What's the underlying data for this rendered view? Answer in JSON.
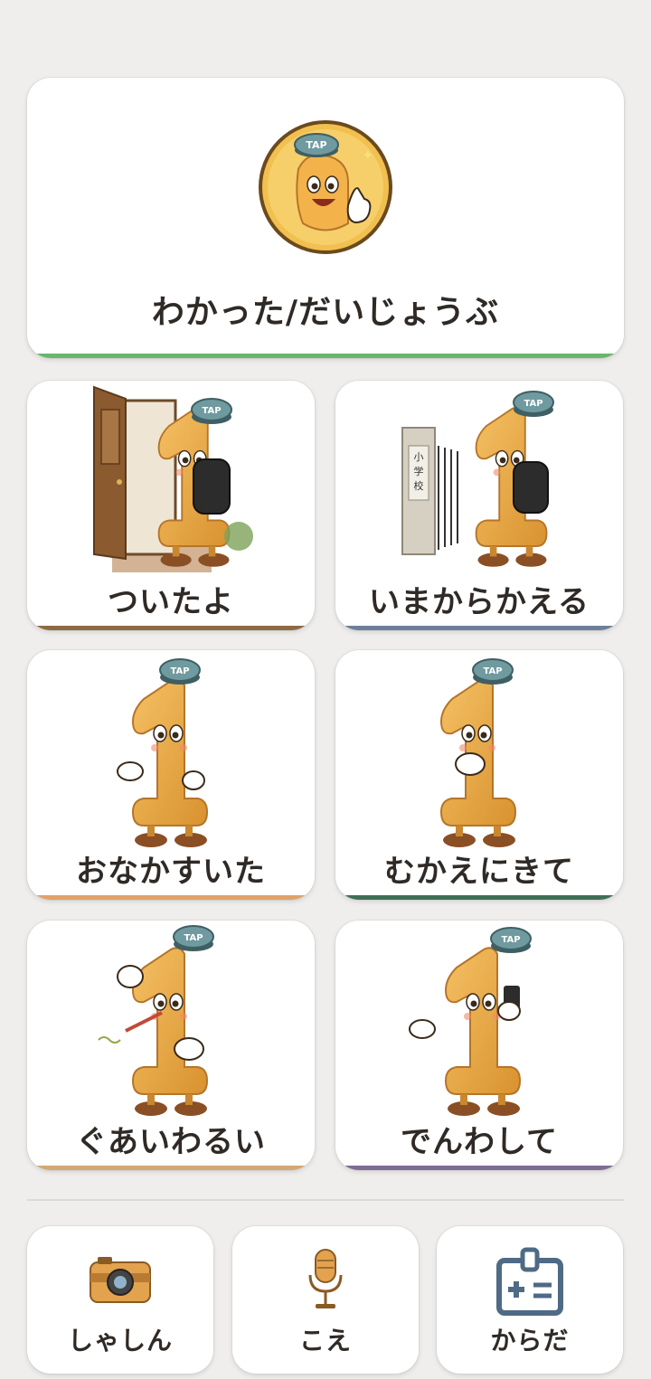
{
  "main_button": {
    "label": "わかった/だいじょうぶ",
    "accent": "#6bb56c",
    "badge_text": "TAP"
  },
  "tiles": [
    {
      "label": "ついたよ",
      "accent": "#8d6a45",
      "badge_text": "TAP",
      "icon": "character-door-icon"
    },
    {
      "label": "いまからかえる",
      "accent": "#6e7f9b",
      "badge_text": "TAP",
      "icon": "character-school-gate-icon",
      "gate_text": "小学校"
    },
    {
      "label": "おなかすいた",
      "accent": "#e0a26a",
      "badge_text": "TAP",
      "icon": "character-hungry-icon"
    },
    {
      "label": "むかえにきて",
      "accent": "#3f6f55",
      "badge_text": "TAP",
      "icon": "character-pleading-icon"
    },
    {
      "label": "ぐあいわるい",
      "accent": "#d3a874",
      "badge_text": "TAP",
      "icon": "character-sick-icon"
    },
    {
      "label": "でんわして",
      "accent": "#7d6c95",
      "badge_text": "TAP",
      "icon": "character-phone-icon"
    }
  ],
  "bottom_buttons": [
    {
      "label": "しゃしん",
      "icon": "camera-icon"
    },
    {
      "label": "こえ",
      "icon": "microphone-icon"
    },
    {
      "label": "からだ",
      "icon": "id-card-icon"
    }
  ]
}
